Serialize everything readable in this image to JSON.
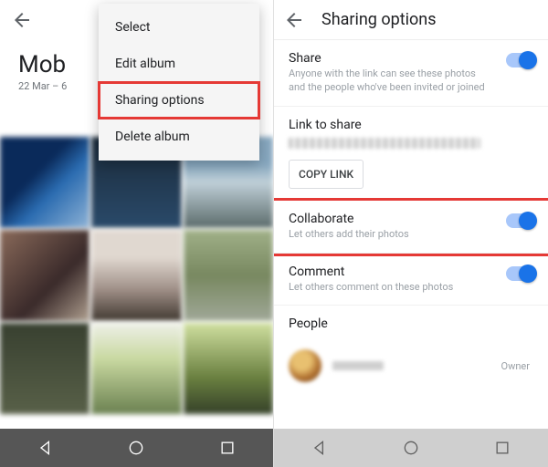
{
  "left": {
    "album_title": "Mob",
    "album_date": "22 Mar – 6",
    "menu": {
      "select": "Select",
      "edit": "Edit album",
      "sharing": "Sharing options",
      "delete": "Delete album"
    }
  },
  "right": {
    "title": "Sharing options",
    "share": {
      "title": "Share",
      "sub": "Anyone with the link can see these photos and the people who've been invited or joined"
    },
    "link": {
      "title": "Link to share",
      "copy": "COPY LINK"
    },
    "collaborate": {
      "title": "Collaborate",
      "sub": "Let others add their photos"
    },
    "comment": {
      "title": "Comment",
      "sub": "Let others comment on these photos"
    },
    "people": {
      "title": "People",
      "owner": "Owner"
    }
  }
}
